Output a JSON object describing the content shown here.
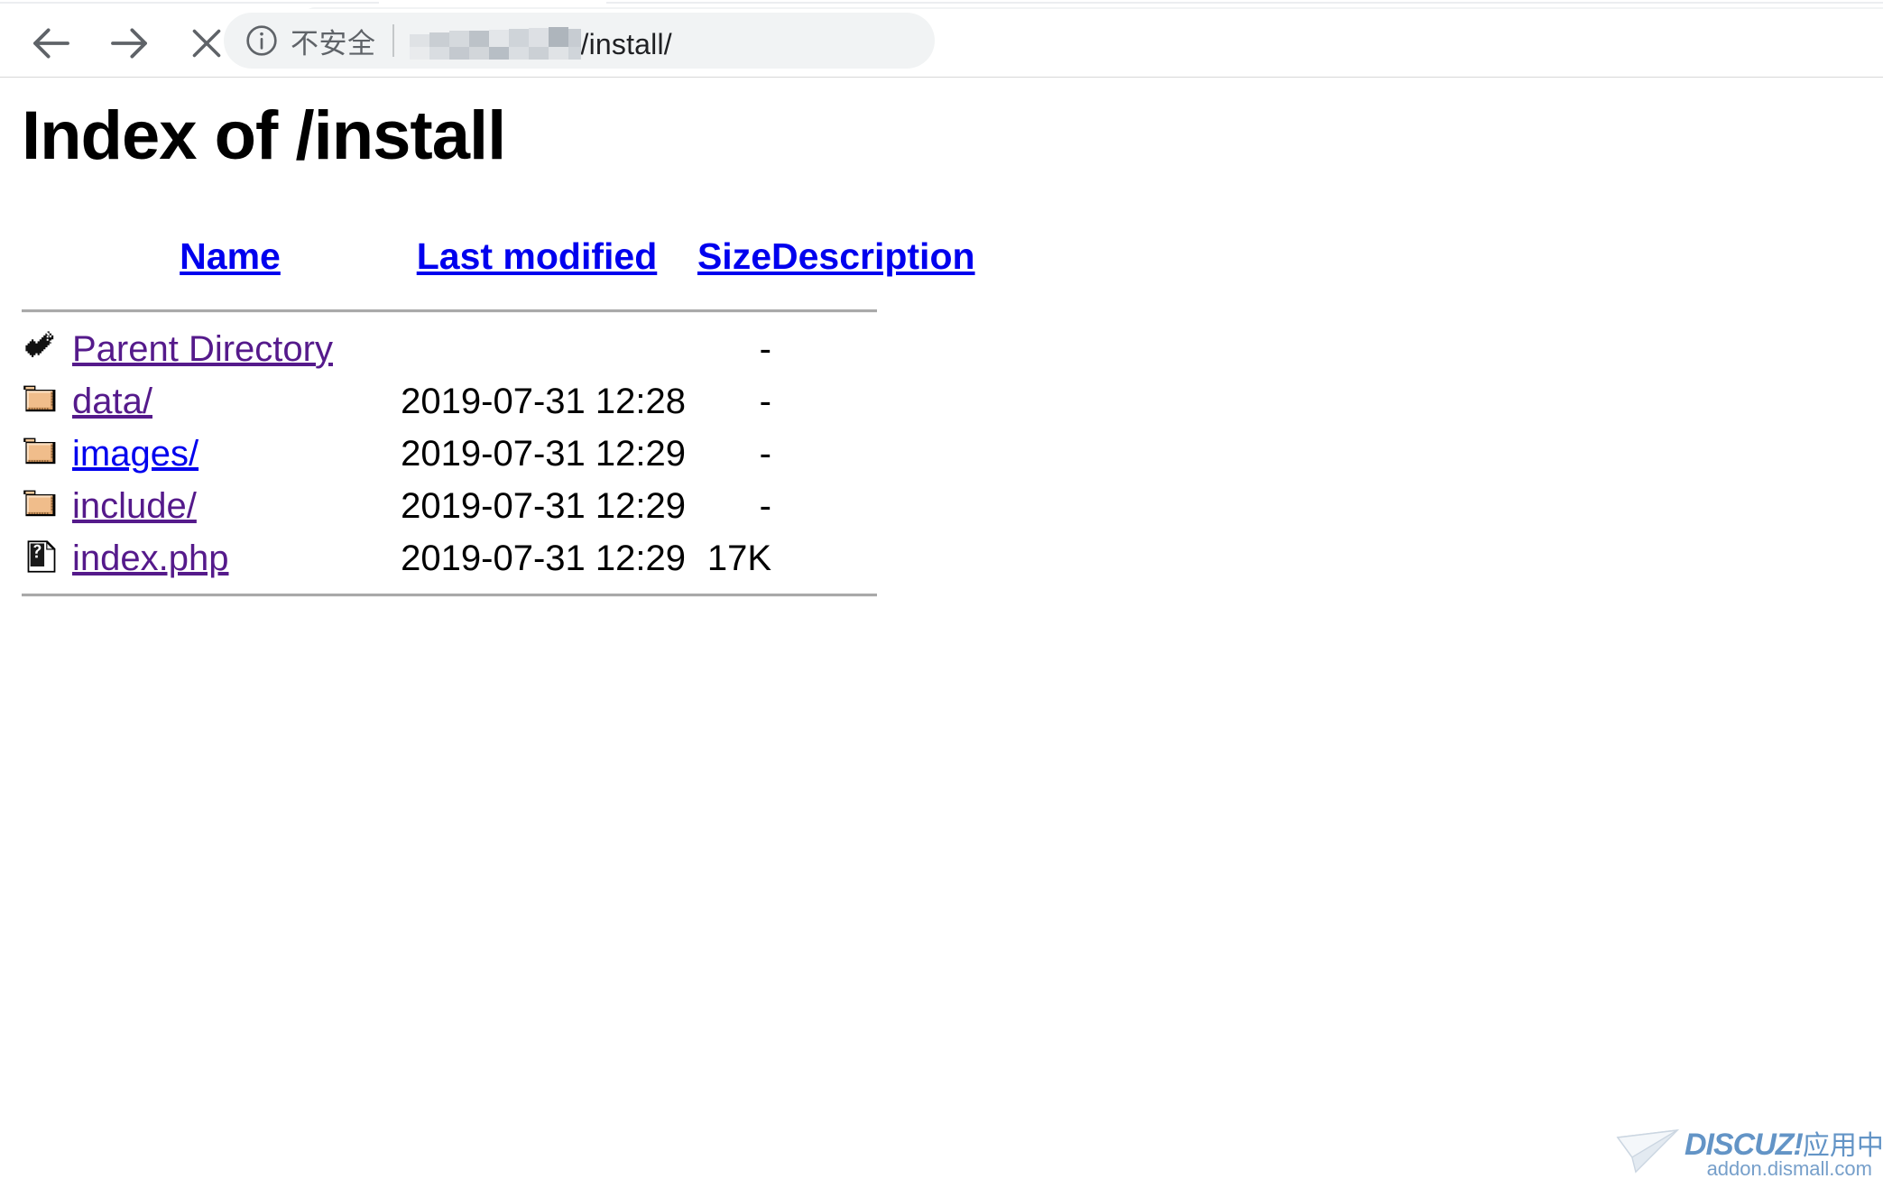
{
  "browser": {
    "back_button": "Back",
    "forward_button": "Forward",
    "stop_button": "Stop",
    "security_label": "不安全",
    "security_icon": "info-circle-icon",
    "url_visible_suffix": "/install/",
    "url_host_redacted": true
  },
  "page": {
    "title": "Index of /install",
    "columns": {
      "name": "Name",
      "last_modified": "Last modified",
      "size": "Size",
      "description": "Description"
    },
    "parent": {
      "icon": "back-arrow-icon",
      "label": "Parent Directory",
      "last_modified": "",
      "size": "-",
      "description": "",
      "visited": true
    },
    "entries": [
      {
        "icon": "folder-icon",
        "name": "data/",
        "last_modified": "2019-07-31 12:28",
        "size": "-",
        "description": "",
        "visited": true
      },
      {
        "icon": "folder-icon",
        "name": "images/",
        "last_modified": "2019-07-31 12:29",
        "size": "-",
        "description": "",
        "visited": false
      },
      {
        "icon": "folder-icon",
        "name": "include/",
        "last_modified": "2019-07-31 12:29",
        "size": "-",
        "description": "",
        "visited": true
      },
      {
        "icon": "unknown-file-icon",
        "name": "index.php",
        "last_modified": "2019-07-31 12:29",
        "size": "17K",
        "description": "",
        "visited": true
      }
    ]
  },
  "watermark": {
    "brand": "DISCUZ!",
    "brand_cn": "应用中心",
    "url": "addon.dismall.com",
    "logo_icon": "paper-plane-icon"
  },
  "colors": {
    "link_unvisited": "#0000ee",
    "link_visited": "#551a8b",
    "text": "#000000",
    "omnibox_bg": "#f1f3f4",
    "security_text": "#5f6368",
    "rule": "#a9a9a9",
    "watermark_blue": "#5b8fc4"
  }
}
